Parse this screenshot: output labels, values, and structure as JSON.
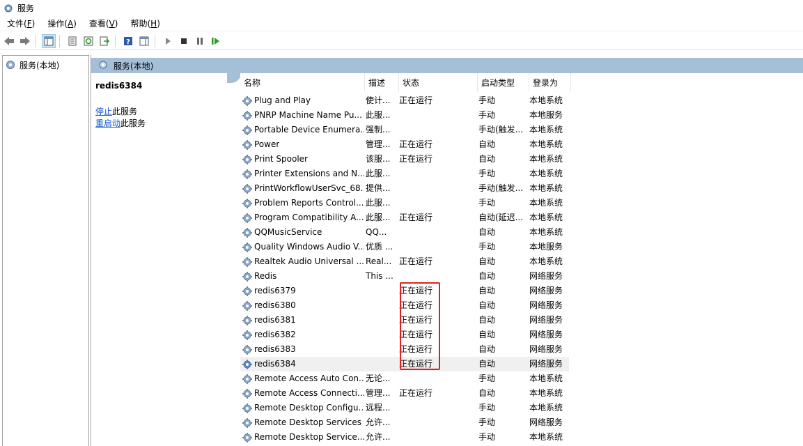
{
  "window": {
    "title": "服务"
  },
  "menu": [
    {
      "label": "文件(",
      "key": "F",
      "suffix": ")"
    },
    {
      "label": "操作(",
      "key": "A",
      "suffix": ")"
    },
    {
      "label": "查看(",
      "key": "V",
      "suffix": ")"
    },
    {
      "label": "帮助(",
      "key": "H",
      "suffix": ")"
    }
  ],
  "tree": {
    "root_label": "服务(本地)"
  },
  "pane": {
    "header": "服务(本地)"
  },
  "detail": {
    "service_name": "redis6384",
    "stop_link": "停止",
    "stop_suffix": "此服务",
    "restart_link": "重启动",
    "restart_suffix": "此服务"
  },
  "columns": {
    "name": "名称",
    "desc": "描述",
    "status": "状态",
    "startup": "启动类型",
    "logon": "登录为"
  },
  "rows": [
    {
      "name": "Plug and Play",
      "desc": "使计...",
      "status": "正在运行",
      "startup": "手动",
      "logon": "本地系统"
    },
    {
      "name": "PNRP Machine Name Pu...",
      "desc": "此服...",
      "status": "",
      "startup": "手动",
      "logon": "本地服务"
    },
    {
      "name": "Portable Device Enumera...",
      "desc": "强制...",
      "status": "",
      "startup": "手动(触发...",
      "logon": "本地系统"
    },
    {
      "name": "Power",
      "desc": "管理...",
      "status": "正在运行",
      "startup": "自动",
      "logon": "本地系统"
    },
    {
      "name": "Print Spooler",
      "desc": "该服...",
      "status": "正在运行",
      "startup": "自动",
      "logon": "本地系统"
    },
    {
      "name": "Printer Extensions and N...",
      "desc": "此服...",
      "status": "",
      "startup": "手动",
      "logon": "本地系统"
    },
    {
      "name": "PrintWorkflowUserSvc_68...",
      "desc": "提供...",
      "status": "",
      "startup": "手动(触发...",
      "logon": "本地系统"
    },
    {
      "name": "Problem Reports Control...",
      "desc": "此服...",
      "status": "",
      "startup": "手动",
      "logon": "本地系统"
    },
    {
      "name": "Program Compatibility A...",
      "desc": "此服...",
      "status": "正在运行",
      "startup": "自动(延迟...",
      "logon": "本地系统"
    },
    {
      "name": "QQMusicService",
      "desc": "QQ...",
      "status": "",
      "startup": "自动",
      "logon": "本地系统"
    },
    {
      "name": "Quality Windows Audio V...",
      "desc": "优质 ...",
      "status": "",
      "startup": "手动",
      "logon": "本地服务"
    },
    {
      "name": "Realtek Audio Universal ...",
      "desc": "Real...",
      "status": "正在运行",
      "startup": "自动",
      "logon": "本地系统"
    },
    {
      "name": "Redis",
      "desc": "This ...",
      "status": "",
      "startup": "自动",
      "logon": "网络服务"
    },
    {
      "name": "redis6379",
      "desc": "",
      "status": "正在运行",
      "startup": "自动",
      "logon": "网络服务"
    },
    {
      "name": "redis6380",
      "desc": "",
      "status": "正在运行",
      "startup": "自动",
      "logon": "网络服务"
    },
    {
      "name": "redis6381",
      "desc": "",
      "status": "正在运行",
      "startup": "自动",
      "logon": "网络服务"
    },
    {
      "name": "redis6382",
      "desc": "",
      "status": "正在运行",
      "startup": "自动",
      "logon": "网络服务"
    },
    {
      "name": "redis6383",
      "desc": "",
      "status": "正在运行",
      "startup": "自动",
      "logon": "网络服务"
    },
    {
      "name": "redis6384",
      "desc": "",
      "status": "正在运行",
      "startup": "自动",
      "logon": "网络服务",
      "selected": true
    },
    {
      "name": "Remote Access Auto Con...",
      "desc": "无论...",
      "status": "",
      "startup": "手动",
      "logon": "本地系统"
    },
    {
      "name": "Remote Access Connecti...",
      "desc": "管理...",
      "status": "正在运行",
      "startup": "自动",
      "logon": "本地系统"
    },
    {
      "name": "Remote Desktop Configu...",
      "desc": "远程...",
      "status": "",
      "startup": "手动",
      "logon": "本地系统"
    },
    {
      "name": "Remote Desktop Services",
      "desc": "允许...",
      "status": "",
      "startup": "手动",
      "logon": "网络服务"
    },
    {
      "name": "Remote Desktop Service...",
      "desc": "允许...",
      "status": "",
      "startup": "手动",
      "logon": "本地系统"
    }
  ],
  "colors": {
    "highlight_box": "#e02020",
    "pane_header": "#a5bfd9",
    "link": "#1155cc"
  }
}
